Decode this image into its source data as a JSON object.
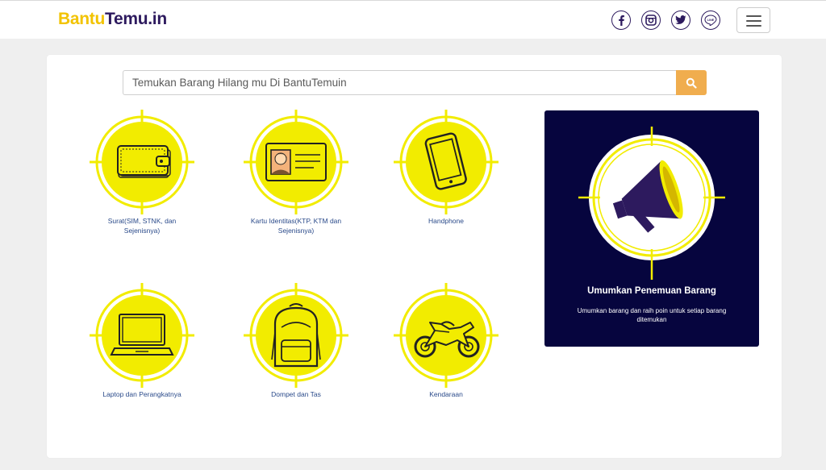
{
  "brand": {
    "part1": "Bantu",
    "part2": "Temu.in"
  },
  "social": [
    {
      "name": "facebook-icon"
    },
    {
      "name": "instagram-icon"
    },
    {
      "name": "twitter-icon"
    },
    {
      "name": "line-icon",
      "text": "LINE"
    }
  ],
  "search": {
    "placeholder": "Temukan Barang Hilang mu Di BantuTemuin"
  },
  "categories": [
    {
      "label": "Surat(SIM, STNK, dan Sejenisnya)",
      "icon": "wallet-icon"
    },
    {
      "label": "Kartu Identitas(KTP, KTM dan Sejenisnya)",
      "icon": "id-card-icon"
    },
    {
      "label": "Handphone",
      "icon": "phone-icon"
    },
    {
      "label": "Laptop dan Perangkatnya",
      "icon": "laptop-icon"
    },
    {
      "label": "Dompet dan Tas",
      "icon": "backpack-icon"
    },
    {
      "label": "Kendaraan",
      "icon": "motorcycle-icon"
    }
  ],
  "announce": {
    "title": "Umumkan Penemuan Barang",
    "description": "Umumkan barang dan raih poin untuk setiap barang ditemukan",
    "icon": "megaphone-icon"
  },
  "colors": {
    "yellow": "#f2ec00",
    "target_ring": "#f2ec00",
    "navy": "#06053e",
    "brand_purple": "#2d1a5e",
    "search_button": "#f0ad4e"
  }
}
